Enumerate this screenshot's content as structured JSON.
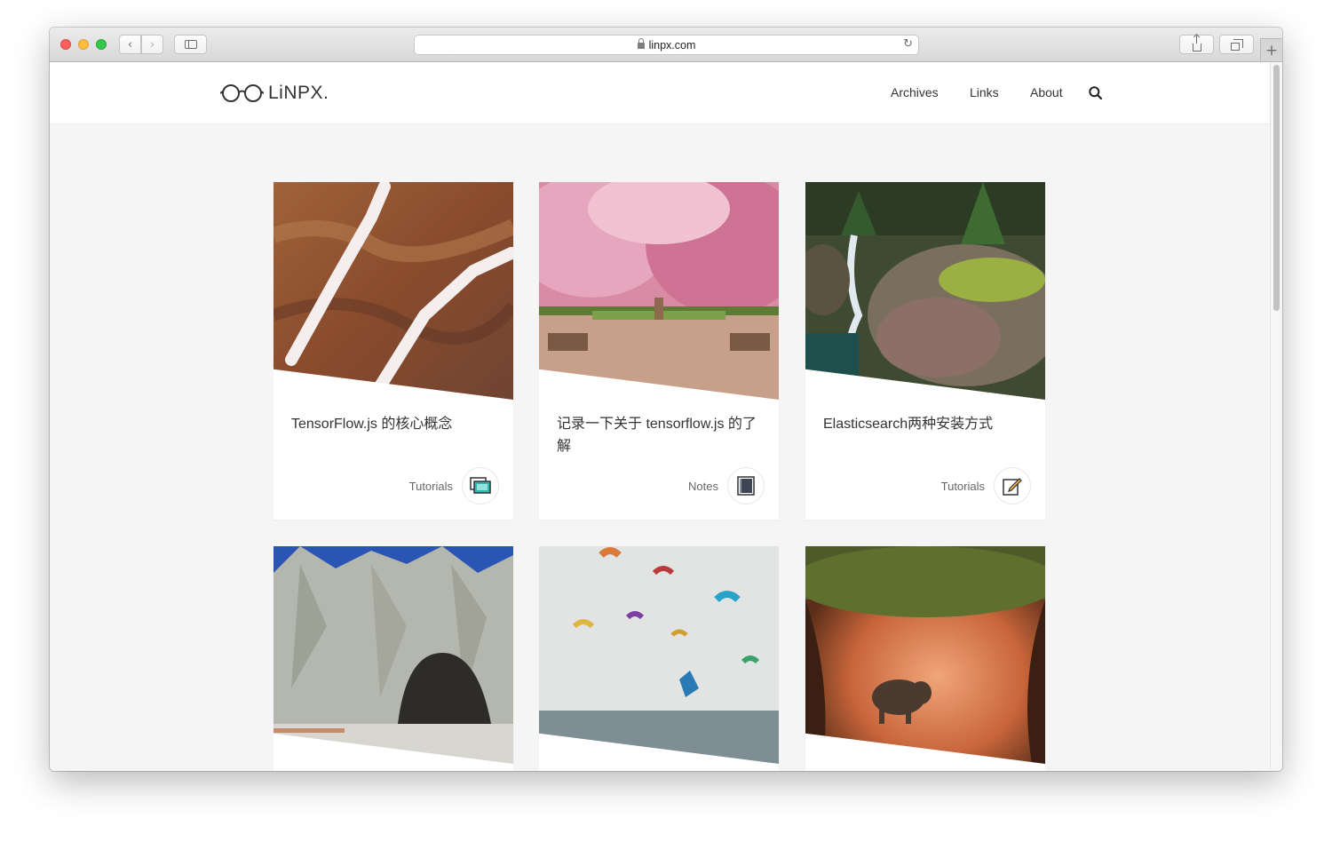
{
  "browser": {
    "url": "linpx.com",
    "new_tab_symbol": "+"
  },
  "site": {
    "logo_text": "LiNPX.",
    "nav": [
      {
        "label": "Archives"
      },
      {
        "label": "Links"
      },
      {
        "label": "About"
      }
    ]
  },
  "posts": [
    {
      "title": "TensorFlow.js 的核心概念",
      "category": "Tutorials",
      "badge_icon": "screens-icon"
    },
    {
      "title": "记录一下关于 tensorflow.js 的了解",
      "category": "Notes",
      "badge_icon": "notebook-icon"
    },
    {
      "title": "Elasticsearch两种安装方式",
      "category": "Tutorials",
      "badge_icon": "edit-icon"
    },
    {
      "title": "",
      "category": ""
    },
    {
      "title": "",
      "category": ""
    },
    {
      "title": "",
      "category": ""
    }
  ],
  "colors": {
    "traffic_red": "#fc605b",
    "traffic_yellow": "#fdbc40",
    "traffic_green": "#34c84a",
    "page_bg": "#f5f5f5",
    "text": "#333333"
  }
}
